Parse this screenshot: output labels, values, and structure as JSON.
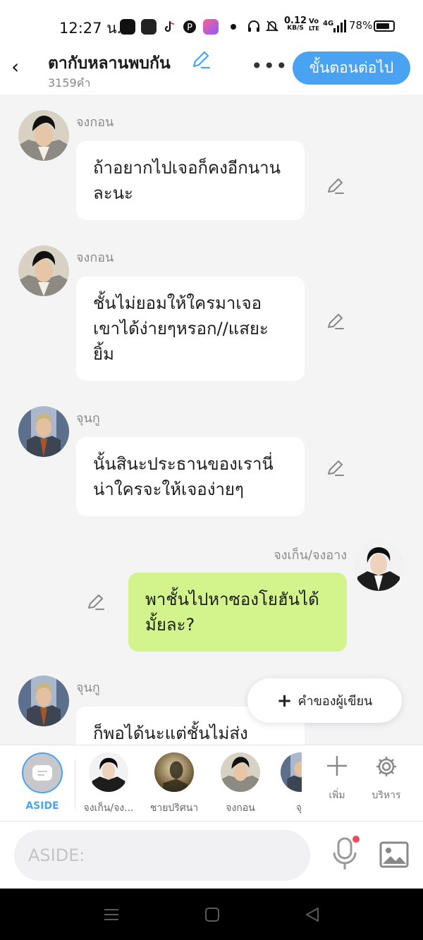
{
  "status_bar": {
    "time": "12:27 น.",
    "net_speed_value": "0.12",
    "net_speed_unit": "KB/S",
    "volte_top": "Vo",
    "volte_bottom": "LTE",
    "signal": "4G",
    "battery": "78%"
  },
  "header": {
    "title": "ตากับหลานพบกัน",
    "word_count": "3159คำ",
    "next_button": "ขั้นตอนต่อไป"
  },
  "messages": [
    {
      "sender": "จงกอน",
      "text": "ถ้าอยากไปเจอก็คงอีกนานละนะ"
    },
    {
      "sender": "จงกอน",
      "text": "ชั้นไม่ยอมให้ใครมาเจอเขาได้ง่ายๆหรอก//แสยะยิ้ม"
    },
    {
      "sender": "จุนกู",
      "text": "นั้นสินะประธานของเรานี่น่าใครจะให้เจอง่ายๆ"
    },
    {
      "sender": "จงเก็น/จงอาง",
      "text": "พาชั้นไปหาซองโยฮันได้มั้ยละ?"
    },
    {
      "sender": "จุนกู",
      "text": "ก็พอได้นะแต่ชั้นไม่ส่ง"
    }
  ],
  "author_fab": {
    "label": "คำของผู้เขียน"
  },
  "characters": [
    {
      "label": "ASIDE"
    },
    {
      "label": "จงเก็น/จง..."
    },
    {
      "label": "ชายปริศนา"
    },
    {
      "label": "จงกอน"
    },
    {
      "label": "จุ"
    }
  ],
  "tools": {
    "add_label": "เพิ่ม",
    "manage_label": "บริหาร"
  },
  "input": {
    "placeholder": "ASIDE:"
  },
  "colors": {
    "accent": "#4aa3f2",
    "my_bubble": "#d3f38c",
    "background": "#f4f4f5"
  }
}
